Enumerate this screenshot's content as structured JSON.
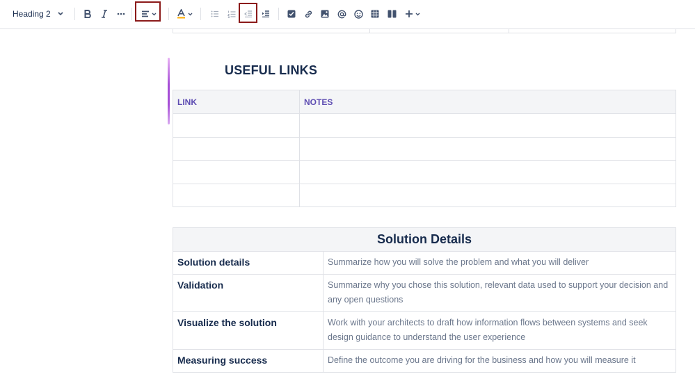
{
  "toolbar": {
    "heading_style": "Heading 2",
    "icons": [
      "bold-icon",
      "italic-icon",
      "more-formatting-icon",
      "align-left-icon",
      "text-color-icon",
      "bullet-list-icon",
      "numbered-list-icon",
      "outdent-icon",
      "indent-icon",
      "task-checkbox-icon",
      "link-icon",
      "image-icon",
      "mention-icon",
      "emoji-icon",
      "table-icon",
      "layout-columns-icon",
      "insert-plus-icon"
    ],
    "highlight_color": "#8b1a1a",
    "text_color_underline": "#ffab00"
  },
  "links_section": {
    "heading": "USEFUL LINKS",
    "columns": [
      "LINK",
      "NOTES"
    ],
    "row_count": 4,
    "accent": "#5e4db2"
  },
  "solution_table": {
    "title": "Solution Details",
    "rows": [
      {
        "label": "Solution details",
        "text": "Summarize how you will solve the problem and what you will deliver"
      },
      {
        "label": "Validation",
        "text": "Summarize why you chose this solution, relevant data used to support your decision and any open questions"
      },
      {
        "label": "Visualize the solution",
        "text": "Work with your architects to draft how information flows between systems and seek design guidance to understand the user experience"
      },
      {
        "label": "Measuring success",
        "text": "Define the outcome you are driving for the business and how you will measure it"
      }
    ]
  }
}
